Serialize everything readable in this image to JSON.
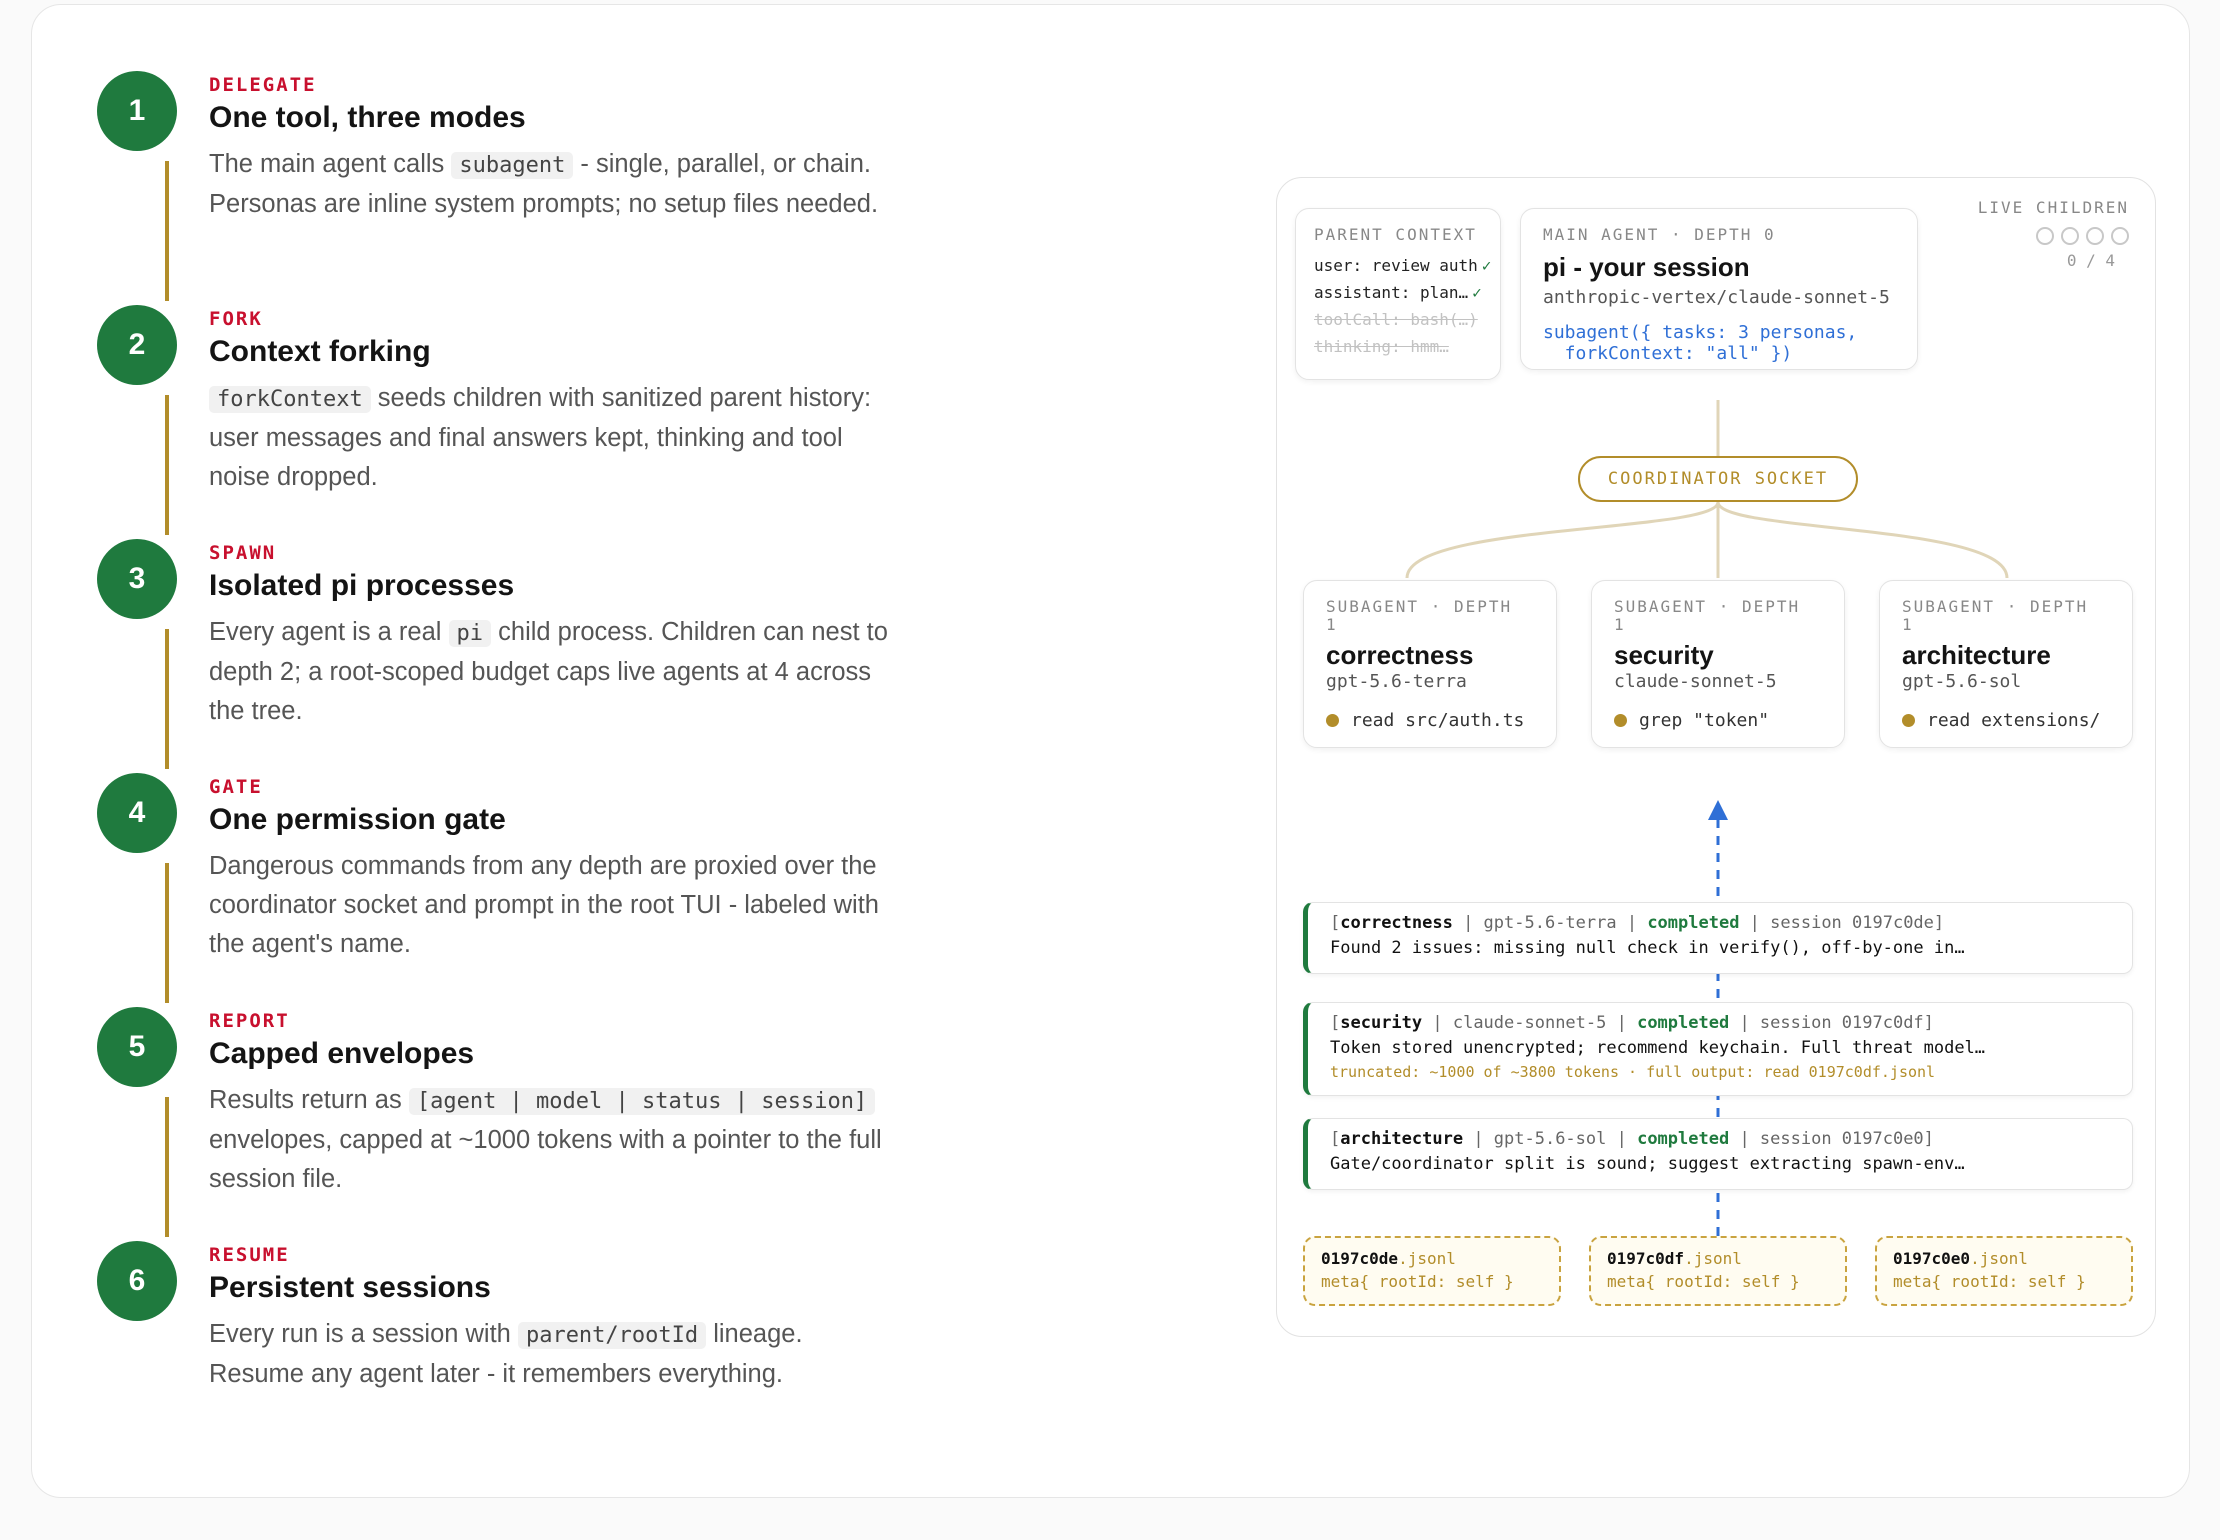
{
  "steps": [
    {
      "num": "1",
      "tag": "DELEGATE",
      "title": "One tool, three modes",
      "desc": [
        {
          "t": "The main agent calls "
        },
        {
          "c": "subagent"
        },
        {
          "t": " - single, parallel, or chain. Personas are inline system prompts; no setup files needed."
        }
      ]
    },
    {
      "num": "2",
      "tag": "FORK",
      "title": "Context forking",
      "desc": [
        {
          "c": "forkContext"
        },
        {
          "t": " seeds children with sanitized parent history: user messages and final answers kept, thinking and tool noise dropped."
        }
      ]
    },
    {
      "num": "3",
      "tag": "SPAWN",
      "title": "Isolated pi processes",
      "desc": [
        {
          "t": "Every agent is a real "
        },
        {
          "c": "pi"
        },
        {
          "t": " child process. Children can nest to depth 2; a root-scoped budget caps live agents at 4 across the tree."
        }
      ]
    },
    {
      "num": "4",
      "tag": "GATE",
      "title": "One permission gate",
      "desc": [
        {
          "t": "Dangerous commands from any depth are proxied over the coordinator socket and prompt in the root TUI - labeled with the agent's name."
        }
      ]
    },
    {
      "num": "5",
      "tag": "REPORT",
      "title": "Capped envelopes",
      "desc": [
        {
          "t": "Results return as "
        },
        {
          "c": "[agent | model | status | session]"
        },
        {
          "t": " envelopes, capped at ~1000 tokens with a pointer to the full session file."
        }
      ]
    },
    {
      "num": "6",
      "tag": "RESUME",
      "title": "Persistent sessions",
      "desc": [
        {
          "t": "Every run is a session with "
        },
        {
          "c": "parent/rootId"
        },
        {
          "t": " lineage. Resume any agent later - it remembers everything."
        }
      ]
    }
  ],
  "diagram": {
    "parent_context": {
      "label": "PARENT CONTEXT",
      "lines": [
        {
          "text": "user: review auth",
          "check": "✓",
          "dim": false
        },
        {
          "text": "assistant: plan…",
          "check": "✓",
          "dim": false
        },
        {
          "text": "toolCall: bash(…)",
          "check": "",
          "dim": true
        },
        {
          "text": "thinking: hmm…",
          "check": "",
          "dim": true
        }
      ]
    },
    "main_agent": {
      "label": "MAIN AGENT · DEPTH 0",
      "title": "pi - your session",
      "model": "anthropic-vertex/claude-sonnet-5",
      "call_line1": "subagent({ tasks: 3 personas,",
      "call_line2": "  forkContext: \"all\" })"
    },
    "live_children": {
      "label": "LIVE CHILDREN",
      "count": "0 / 4",
      "max": 4,
      "live": 0
    },
    "socket_label": "COORDINATOR SOCKET",
    "subagents": [
      {
        "label": "SUBAGENT · DEPTH",
        "depth": "1",
        "name": "correctness",
        "model": "gpt-5.6-terra",
        "activity": "read src/auth.ts"
      },
      {
        "label": "SUBAGENT · DEPTH",
        "depth": "1",
        "name": "security",
        "model": "claude-sonnet-5",
        "activity": "grep \"token\""
      },
      {
        "label": "SUBAGENT · DEPTH",
        "depth": "1",
        "name": "architecture",
        "model": "gpt-5.6-sol",
        "activity": "read extensions/"
      }
    ],
    "envelopes": [
      {
        "open": "[",
        "agent": "correctness",
        "model": " | gpt-5.6-terra | ",
        "status": "completed",
        "session": " | session 0197c0de]",
        "body": "Found 2 issues: missing null check in verify(), off-by-one in…",
        "truncated": ""
      },
      {
        "open": "[",
        "agent": "security",
        "model": " | claude-sonnet-5 | ",
        "status": "completed",
        "session": " | session 0197c0df]",
        "body": "Token stored unencrypted; recommend keychain. Full threat model…",
        "truncated": "truncated: ~1000 of ~3800 tokens · full output: read 0197c0df.jsonl"
      },
      {
        "open": "[",
        "agent": "architecture",
        "model": " | gpt-5.6-sol | ",
        "status": "completed",
        "session": " | session 0197c0e0]",
        "body": "Gate/coordinator split is sound; suggest extracting spawn-env…",
        "truncated": ""
      }
    ],
    "files": [
      {
        "id": "0197c0de",
        "ext": ".jsonl",
        "meta": "meta{ rootId: self }"
      },
      {
        "id": "0197c0df",
        "ext": ".jsonl",
        "meta": "meta{ rootId: self }"
      },
      {
        "id": "0197c0e0",
        "ext": ".jsonl",
        "meta": "meta{ rootId: self }"
      }
    ],
    "colors": {
      "green": "#1f7a3e",
      "gold": "#b28d2a",
      "red": "#c8102e",
      "blue": "#2f6fd6"
    }
  }
}
